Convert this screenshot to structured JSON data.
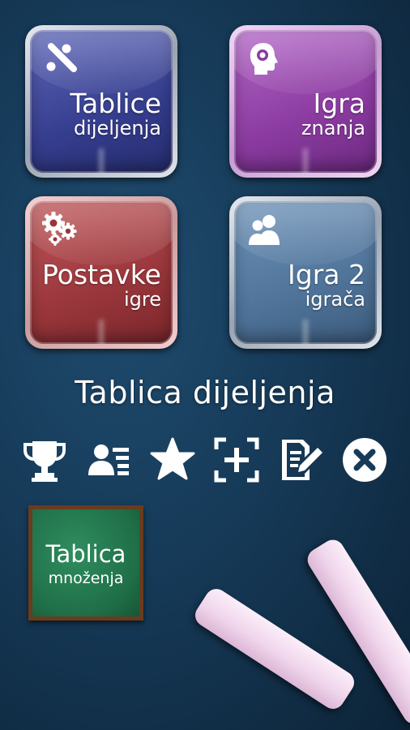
{
  "tiles": {
    "division": {
      "line1": "Tablice",
      "line2": "dijeljenja",
      "icon": "divide-icon"
    },
    "quiz": {
      "line1": "Igra",
      "line2": "znanja",
      "icon": "head-icon"
    },
    "settings": {
      "line1": "Postavke",
      "line2": "igre",
      "icon": "gears-icon"
    },
    "two_player": {
      "line1": "Igra 2",
      "line2": "igrača",
      "icon": "users-icon"
    }
  },
  "title": "Tablica dijeljenja",
  "toolbar": [
    "trophy-icon",
    "profile-list-icon",
    "star-icon",
    "add-frame-icon",
    "edit-doc-icon",
    "close-icon"
  ],
  "multiplication_board": {
    "line1": "Tablica",
    "line2": "množenja"
  },
  "colors": {
    "background": "#163a58",
    "division_tile": "#353d8e",
    "quiz_tile": "#8b3ba0",
    "settings_tile": "#99363b",
    "two_player_tile": "#4f7399",
    "board_green": "#1f6e47"
  }
}
